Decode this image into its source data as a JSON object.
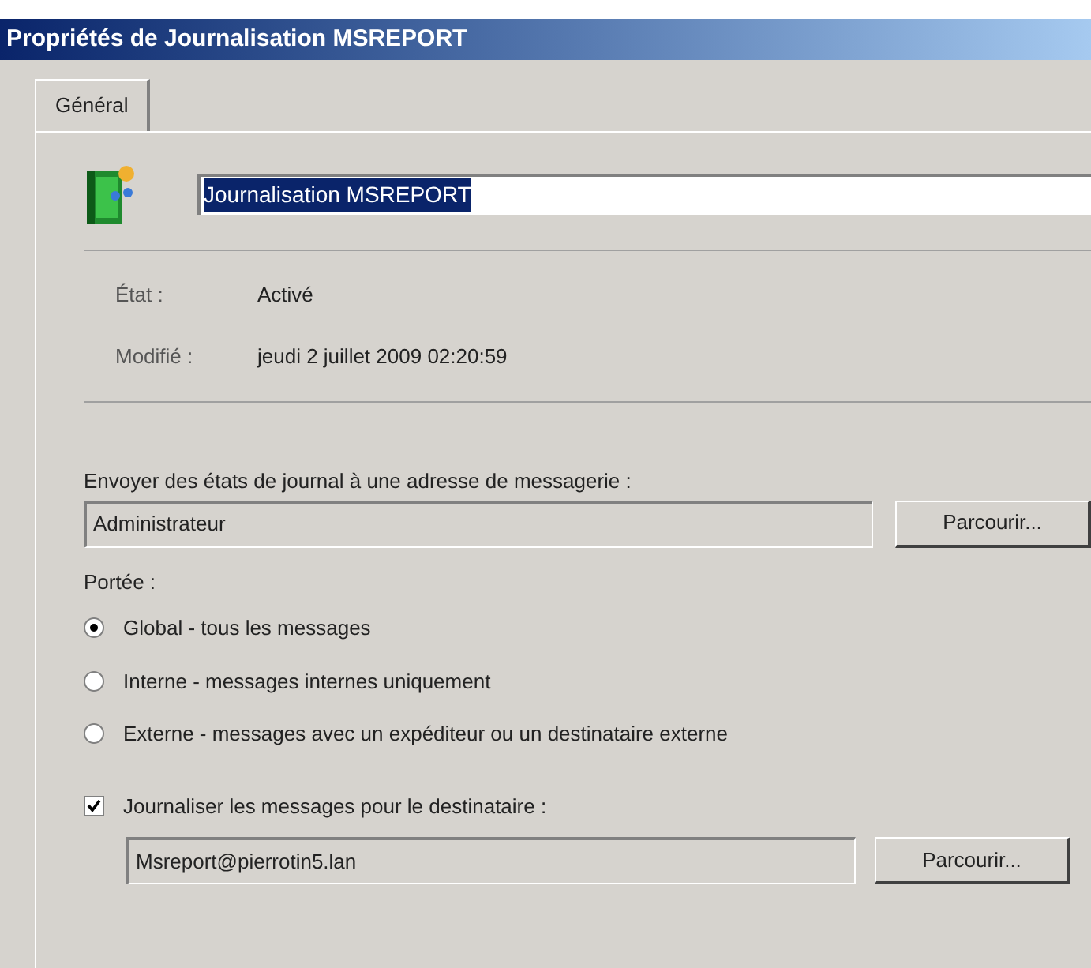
{
  "window": {
    "title": "Propriétés de Journalisation MSREPORT"
  },
  "tabs": [
    {
      "label": "Général",
      "selected": true
    }
  ],
  "name_field": {
    "value": "Journalisation MSREPORT",
    "selected": true
  },
  "info": [
    {
      "label": "État :",
      "value": "Activé"
    },
    {
      "label": "Modifié :",
      "value": "jeudi 2 juillet 2009 02:20:59"
    }
  ],
  "report_address": {
    "label": "Envoyer des états de journal à une adresse de messagerie :",
    "value": "Administrateur",
    "button": "Parcourir..."
  },
  "scope": {
    "label": "Portée :",
    "options": [
      {
        "label": "Global - tous les messages",
        "selected": true
      },
      {
        "label": "Interne - messages internes uniquement",
        "selected": false
      },
      {
        "label": "Externe - messages avec un expéditeur ou un destinataire externe",
        "selected": false
      }
    ]
  },
  "recipient": {
    "label": "Journaliser les messages pour le destinataire :",
    "checked": true,
    "value": "Msreport@pierrotin5.lan",
    "button": "Parcourir..."
  }
}
